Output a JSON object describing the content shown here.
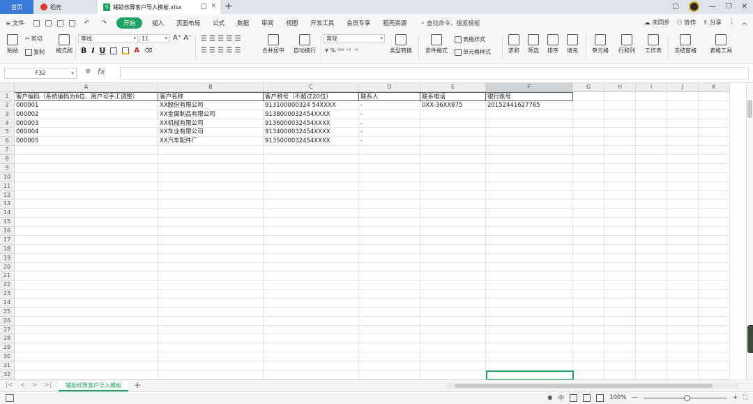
{
  "tabs": {
    "home": "首页",
    "docer": "稻壳",
    "file": "辅助核算客户导入模板.xlsx"
  },
  "menubar": {
    "file": "文件",
    "items": [
      "开始",
      "插入",
      "页面布局",
      "公式",
      "数据",
      "审阅",
      "视图",
      "开发工具",
      "会员专享",
      "稻壳资源"
    ],
    "search_placeholder": "查找命令、搜索模板",
    "unsynced": "未同步",
    "collab": "协作",
    "share": "分享"
  },
  "ribbon": {
    "paste": "粘贴",
    "cut": "剪切",
    "copy": "复制",
    "format_painter": "格式刷",
    "font_name": "等线",
    "font_size": "11",
    "number_format": "常规",
    "merge_center": "合并居中",
    "wrap_text": "自动换行",
    "type_convert": "类型转换",
    "cond_format": "条件格式",
    "table_style": "表格样式",
    "cell_style": "单元格样式",
    "sum": "求和",
    "filter": "筛选",
    "sort": "排序",
    "fill": "填充",
    "cell": "单元格",
    "row_col": "行和列",
    "worksheet": "工作表",
    "freeze": "冻结窗格",
    "table_tools": "表格工具"
  },
  "formula": {
    "cell_ref": "F32",
    "fx": "fx",
    "content": ""
  },
  "sheet": {
    "columns": [
      "A",
      "B",
      "C",
      "D",
      "E",
      "F",
      "G",
      "H",
      "I",
      "J",
      "K"
    ],
    "selected_col": "F",
    "rows": [
      [
        "客户编码（系统编码为6位、用户可手工调整）",
        "客户名称",
        "客户税号（不超过20位）",
        "联系人",
        "联系电话",
        "银行账号"
      ],
      [
        "000001",
        "XX股份有限公司",
        "913100000324 54XXXX",
        "-",
        "0XX-36XX875",
        "20152441627765"
      ],
      [
        "000002",
        "XX金属制品有限公司",
        "9138000032454XXXX",
        "-",
        "",
        ""
      ],
      [
        "000003",
        "XX机械有限公司",
        "9136000032454XXXX",
        "-",
        "",
        ""
      ],
      [
        "000004",
        "XX车业有限公司",
        "9134000032454XXXX",
        "-",
        "",
        ""
      ],
      [
        "000005",
        "XX汽车配件厂",
        "9135000032454XXXX",
        "-",
        "",
        ""
      ]
    ],
    "row_count": 32,
    "tab_name": "辅助核算客户导入模板"
  },
  "status": {
    "zoom": "100%"
  },
  "colors": {
    "accent": "#1ea362",
    "home_tab": "#3b7ad9"
  }
}
